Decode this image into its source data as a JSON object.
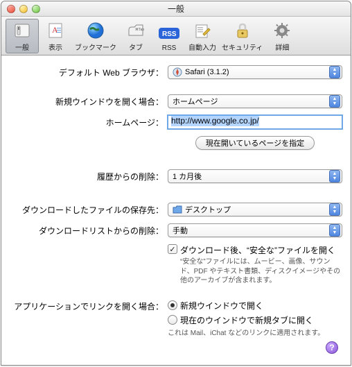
{
  "window": {
    "title": "一般"
  },
  "toolbar": {
    "items": [
      {
        "label": "一般"
      },
      {
        "label": "表示"
      },
      {
        "label": "ブックマーク"
      },
      {
        "label": "タブ"
      },
      {
        "label": "RSS"
      },
      {
        "label": "自動入力"
      },
      {
        "label": "セキュリティ"
      },
      {
        "label": "詳細"
      }
    ]
  },
  "labels": {
    "default_browser": "デフォルト Web ブラウザ：",
    "new_window": "新規ウインドウを開く場合：",
    "homepage": "ホームページ：",
    "set_current": "現在開いているページを指定",
    "history_remove": "履歴からの削除：",
    "download_location": "ダウンロードしたファイルの保存先：",
    "download_list_remove": "ダウンロードリストからの削除：",
    "safe_open": "ダウンロード後、“安全な”ファイルを開く",
    "safe_note": "“安全な”ファイルには、ムービー、画像、サウンド、PDF やテキスト書類、ディスクイメージやその他のアーカイブが含まれます。",
    "link_open": "アプリケーションでリンクを開く場合：",
    "link_open_newwin": "新規ウインドウで開く",
    "link_open_newtab": "現在のウインドウで新規タブに開く",
    "link_open_note": "これは Mail、iChat などのリンクに適用されます。"
  },
  "values": {
    "default_browser": "Safari (3.1.2)",
    "new_window": "ホームページ",
    "homepage_url": "http://www.google.co.jp/",
    "history_remove": "1 カ月後",
    "download_location": "デスクトップ",
    "download_list_remove": "手動",
    "safe_open_checked": true,
    "link_open_radio": "newwin"
  }
}
